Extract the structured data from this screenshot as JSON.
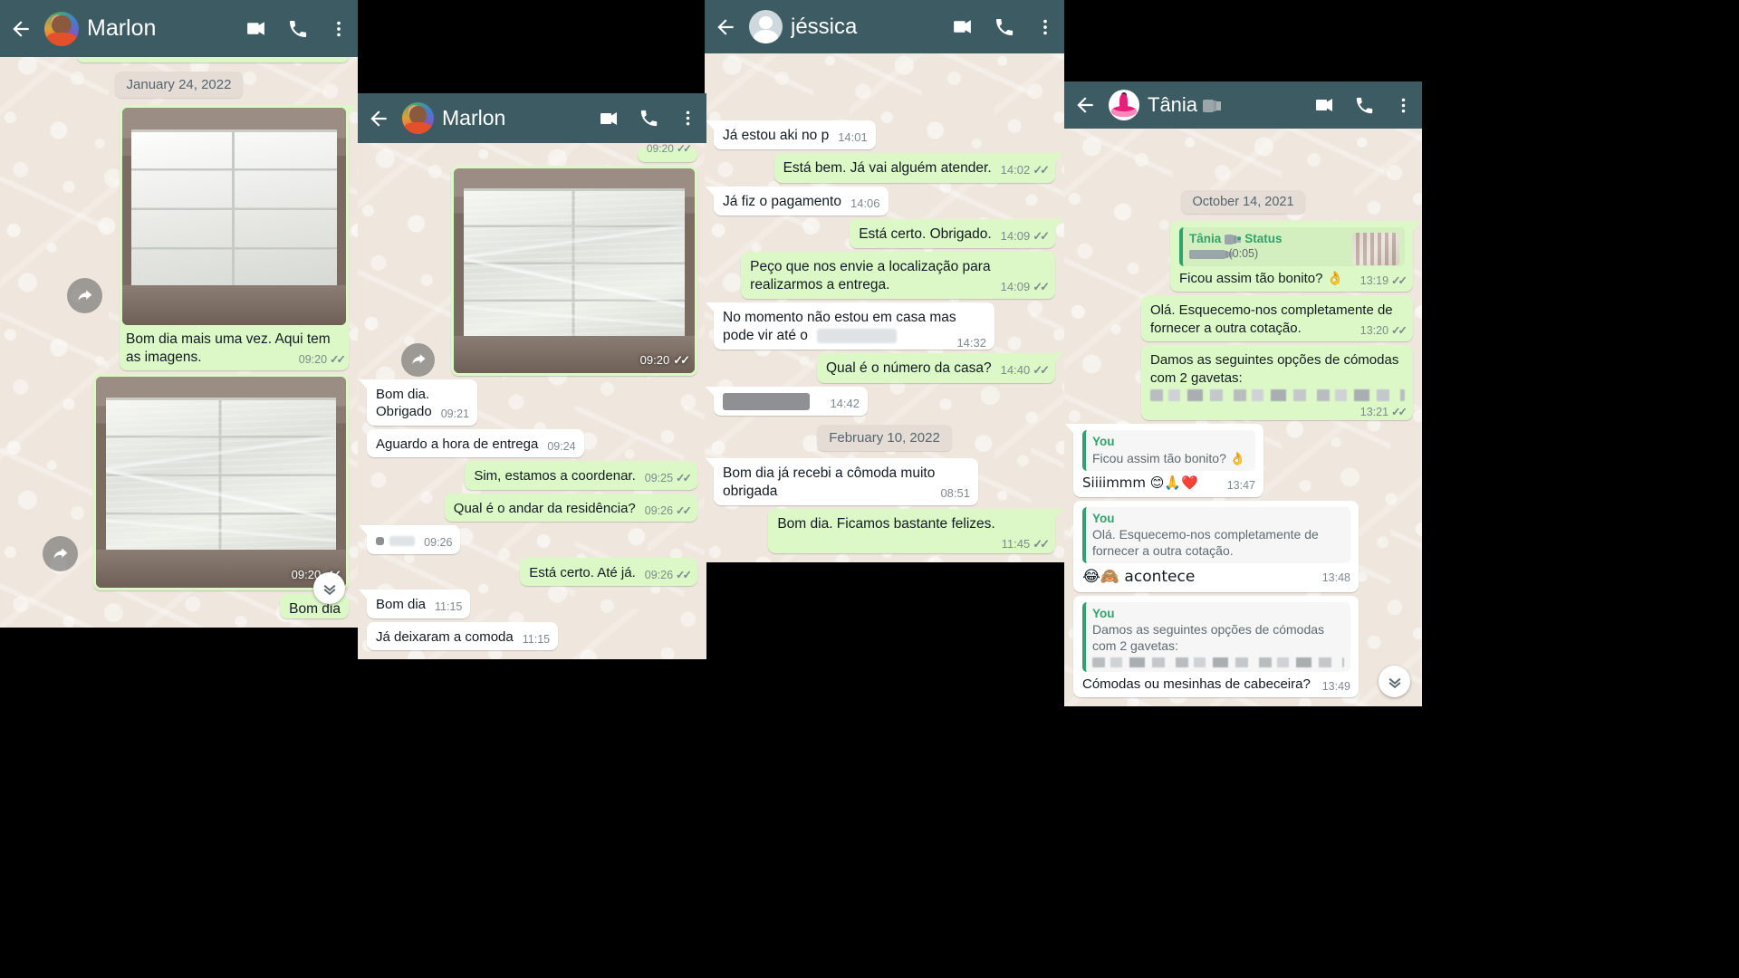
{
  "screen": {
    "background": "#000000"
  },
  "theme": {
    "header_bg": "#3c5b63",
    "chat_bg": "#efe7de",
    "out_bubble": "#dcf8c6",
    "in_bubble": "#ffffff",
    "quote_accent": "#2fa36b",
    "meta_text": "#7d8a8f"
  },
  "panels": [
    {
      "id": "panel-marlon-1",
      "header": {
        "back_icon": "arrow-left-icon",
        "avatar": "contact-avatar-marlon",
        "title": "Marlon",
        "actions": [
          "video-call-icon",
          "voice-call-icon",
          "more-options-icon"
        ]
      },
      "date_divider": "January 24, 2022",
      "messages": [
        {
          "kind": "image",
          "dir": "out",
          "time": "09:20",
          "ticks": "✓✓",
          "photo": "dresser-photo",
          "forward": true
        },
        {
          "kind": "text",
          "dir": "out",
          "text": "Bom dia mais uma vez. Aqui tem as imagens.",
          "time": "09:20",
          "ticks": "✓✓"
        },
        {
          "kind": "image",
          "dir": "out",
          "time": "09:20",
          "ticks": "✓✓",
          "photo": "dresser-wrapped-photo",
          "forward": true
        },
        {
          "kind": "text",
          "dir": "out",
          "text": "Bom dia",
          "time": "",
          "ticks": ""
        }
      ],
      "scroll_down_icon": "chevron-double-down-icon"
    },
    {
      "id": "panel-marlon-2",
      "header": {
        "back_icon": "arrow-left-icon",
        "avatar": "contact-avatar-marlon",
        "title": "Marlon",
        "actions": [
          "video-call-icon",
          "voice-call-icon",
          "more-options-icon"
        ]
      },
      "clipped_time_top": "09:20",
      "messages": [
        {
          "kind": "image",
          "dir": "out",
          "time": "09:20",
          "ticks": "✓✓",
          "photo": "dresser-wrapped-photo",
          "forward": true
        },
        {
          "kind": "text",
          "dir": "in",
          "text": "Bom dia.\nObrigado",
          "time": "09:21",
          "ticks": ""
        },
        {
          "kind": "text",
          "dir": "in",
          "text": "Aguardo a hora de entrega",
          "time": "09:24",
          "ticks": ""
        },
        {
          "kind": "text",
          "dir": "out",
          "text": "Sim, estamos a coordenar.",
          "time": "09:25",
          "ticks": "✓✓"
        },
        {
          "kind": "text",
          "dir": "out",
          "text": "Qual é o andar da residência?",
          "time": "09:26",
          "ticks": "✓✓"
        },
        {
          "kind": "redacted",
          "dir": "in",
          "text": "",
          "time": "09:26",
          "ticks": ""
        },
        {
          "kind": "text",
          "dir": "out",
          "text": "Está certo. Até já.",
          "time": "09:26",
          "ticks": "✓✓"
        },
        {
          "kind": "text",
          "dir": "in",
          "text": "Bom dia",
          "time": "11:15",
          "ticks": ""
        },
        {
          "kind": "text",
          "dir": "in",
          "text": "Já deixaram a comoda",
          "time": "11:15",
          "ticks": ""
        }
      ]
    },
    {
      "id": "panel-jessica",
      "header": {
        "back_icon": "arrow-left-icon",
        "avatar": "contact-avatar-default",
        "title": "jéssica",
        "actions": [
          "video-call-icon",
          "voice-call-icon",
          "more-options-icon"
        ]
      },
      "date_divider": "February 10, 2022",
      "messages": [
        {
          "kind": "text",
          "dir": "in",
          "text": "Já estou aki no p",
          "time": "14:01",
          "ticks": ""
        },
        {
          "kind": "text",
          "dir": "out",
          "text": "Está bem. Já vai alguém atender.",
          "time": "14:02",
          "ticks": "✓✓"
        },
        {
          "kind": "text",
          "dir": "in",
          "text": "Já fiz o pagamento",
          "time": "14:06",
          "ticks": ""
        },
        {
          "kind": "text",
          "dir": "out",
          "text": "Está certo. Obrigado.",
          "time": "14:09",
          "ticks": "✓✓"
        },
        {
          "kind": "text",
          "dir": "out",
          "text": "Peço que nos envie a localização para realizarmos a entrega.",
          "time": "14:09",
          "ticks": "✓✓"
        },
        {
          "kind": "text_redacted",
          "dir": "in",
          "text": "No momento não estou em casa mas pode vir até o",
          "time": "14:32",
          "ticks": ""
        },
        {
          "kind": "text",
          "dir": "out",
          "text": "Qual é o número da casa?",
          "time": "14:40",
          "ticks": "✓✓"
        },
        {
          "kind": "redacted",
          "dir": "in",
          "text": "",
          "time": "14:42",
          "ticks": ""
        },
        {
          "kind": "text",
          "dir": "in",
          "text": "Bom dia já recebi a cômoda muito obrigada",
          "time": "08:51",
          "ticks": ""
        },
        {
          "kind": "text",
          "dir": "out",
          "text": "Bom dia. Ficamos bastante felizes.",
          "time": "11:45",
          "ticks": "✓✓"
        }
      ]
    },
    {
      "id": "panel-tania",
      "header": {
        "back_icon": "arrow-left-icon",
        "avatar": "contact-avatar-tania",
        "title": "Tânia ",
        "title_redacted": true,
        "actions": [
          "video-call-icon",
          "voice-call-icon",
          "more-options-icon"
        ]
      },
      "date_divider": "October 14, 2021",
      "messages": [
        {
          "kind": "quote_reply",
          "dir": "out",
          "quote": {
            "author": "Tânia ",
            "author_suffix": "• Status",
            "duration": "(0:05)",
            "has_thumb": true,
            "redacted_author": true
          },
          "text": "Ficou assim tão bonito? 👌",
          "time": "13:19",
          "ticks": "✓✓"
        },
        {
          "kind": "text",
          "dir": "out",
          "text": "Olá. Esquecemo-nos completamente de fornecer a outra cotação.",
          "time": "13:20",
          "ticks": "✓✓"
        },
        {
          "kind": "text_redacted_lines",
          "dir": "out",
          "text": "Damos as seguintes opções de cómodas com 2 gavetas:",
          "time": "13:21",
          "ticks": "✓✓"
        },
        {
          "kind": "quote_reply",
          "dir": "in",
          "quote": {
            "author": "You",
            "text": "Ficou assim tão bonito? 👌"
          },
          "text": "Siiiimmm 😊🙏❤️",
          "time": "13:47",
          "ticks": ""
        },
        {
          "kind": "quote_reply",
          "dir": "in",
          "quote": {
            "author": "You",
            "text": "Olá. Esquecemo-nos completamente de fornecer a outra cotação."
          },
          "text": "😂🙈 acontece",
          "time": "13:48",
          "ticks": ""
        },
        {
          "kind": "quote_reply_redacted",
          "dir": "in",
          "quote": {
            "author": "You",
            "text": "Damos as seguintes opções de cómodas com 2 gavetas:"
          },
          "text": "Cómodas ou mesinhas de cabeceira?",
          "time": "13:49",
          "ticks": ""
        }
      ],
      "scroll_down_icon": "chevron-double-down-icon"
    }
  ]
}
